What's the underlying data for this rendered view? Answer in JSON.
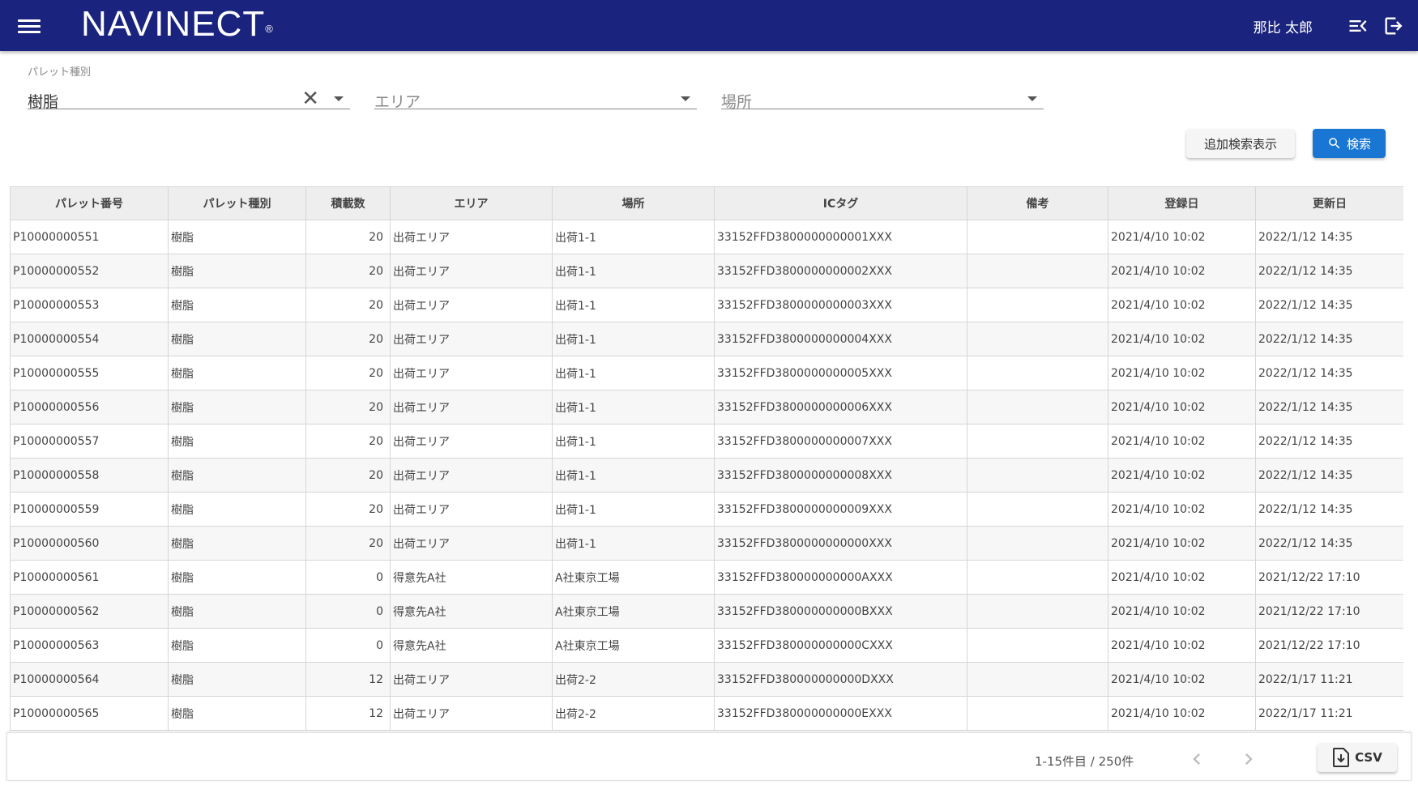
{
  "header": {
    "logo": "NAVINECT",
    "logo_mark": "®",
    "user_name": "那比 太郎",
    "menu_icon": "hamburger-menu-icon",
    "list_icon": "menu-collapse-icon",
    "logout_icon": "logout-icon",
    "bg_color": "#1a237e"
  },
  "search": {
    "pallet_type": {
      "label": "パレット種別",
      "value": "樹脂"
    },
    "area": {
      "placeholder": "エリア"
    },
    "place": {
      "placeholder": "場所"
    },
    "advanced_button": "追加検索表示",
    "search_button": "検索",
    "search_button_color": "#1976d2"
  },
  "table": {
    "columns": [
      "パレット番号",
      "パレット種別",
      "積載数",
      "エリア",
      "場所",
      "ICタグ",
      "備考",
      "登録日",
      "更新日"
    ],
    "rows": [
      [
        "P10000000551",
        "樹脂",
        "20",
        "出荷エリア",
        "出荷1-1",
        "33152FFD3800000000001XXX",
        "",
        "2021/4/10  10:02",
        "2022/1/12 14:35"
      ],
      [
        "P10000000552",
        "樹脂",
        "20",
        "出荷エリア",
        "出荷1-1",
        "33152FFD3800000000002XXX",
        "",
        "2021/4/10  10:02",
        "2022/1/12 14:35"
      ],
      [
        "P10000000553",
        "樹脂",
        "20",
        "出荷エリア",
        "出荷1-1",
        "33152FFD3800000000003XXX",
        "",
        "2021/4/10  10:02",
        "2022/1/12 14:35"
      ],
      [
        "P10000000554",
        "樹脂",
        "20",
        "出荷エリア",
        "出荷1-1",
        "33152FFD3800000000004XXX",
        "",
        "2021/4/10  10:02",
        "2022/1/12 14:35"
      ],
      [
        "P10000000555",
        "樹脂",
        "20",
        "出荷エリア",
        "出荷1-1",
        "33152FFD3800000000005XXX",
        "",
        "2021/4/10  10:02",
        "2022/1/12 14:35"
      ],
      [
        "P10000000556",
        "樹脂",
        "20",
        "出荷エリア",
        "出荷1-1",
        "33152FFD3800000000006XXX",
        "",
        "2021/4/10  10:02",
        "2022/1/12 14:35"
      ],
      [
        "P10000000557",
        "樹脂",
        "20",
        "出荷エリア",
        "出荷1-1",
        "33152FFD3800000000007XXX",
        "",
        "2021/4/10  10:02",
        "2022/1/12 14:35"
      ],
      [
        "P10000000558",
        "樹脂",
        "20",
        "出荷エリア",
        "出荷1-1",
        "33152FFD3800000000008XXX",
        "",
        "2021/4/10  10:02",
        "2022/1/12 14:35"
      ],
      [
        "P10000000559",
        "樹脂",
        "20",
        "出荷エリア",
        "出荷1-1",
        "33152FFD3800000000009XXX",
        "",
        "2021/4/10  10:02",
        "2022/1/12 14:35"
      ],
      [
        "P10000000560",
        "樹脂",
        "20",
        "出荷エリア",
        "出荷1-1",
        "33152FFD3800000000000XXX",
        "",
        "2021/4/10  10:02",
        "2022/1/12 14:35"
      ],
      [
        "P10000000561",
        "樹脂",
        "0",
        "得意先A社",
        "A社東京工場",
        "33152FFD380000000000AXXX",
        "",
        "2021/4/10  10:02",
        "2021/12/22 17:10"
      ],
      [
        "P10000000562",
        "樹脂",
        "0",
        "得意先A社",
        "A社東京工場",
        "33152FFD380000000000BXXX",
        "",
        "2021/4/10  10:02",
        "2021/12/22 17:10"
      ],
      [
        "P10000000563",
        "樹脂",
        "0",
        "得意先A社",
        "A社東京工場",
        "33152FFD380000000000CXXX",
        "",
        "2021/4/10  10:02",
        "2021/12/22 17:10"
      ],
      [
        "P10000000564",
        "樹脂",
        "12",
        "出荷エリア",
        "出荷2-2",
        "33152FFD380000000000DXXX",
        "",
        "2021/4/10  10:02",
        "2022/1/17 11:21"
      ],
      [
        "P10000000565",
        "樹脂",
        "12",
        "出荷エリア",
        "出荷2-2",
        "33152FFD380000000000EXXX",
        "",
        "2021/4/10  10:02",
        "2022/1/17 11:21"
      ]
    ]
  },
  "footer": {
    "page_info": "1-15件目 / 250件",
    "prev_icon": "chevron-left-icon",
    "next_icon": "chevron-right-icon",
    "csv_label": "CSV",
    "csv_icon": "file-download-icon"
  }
}
